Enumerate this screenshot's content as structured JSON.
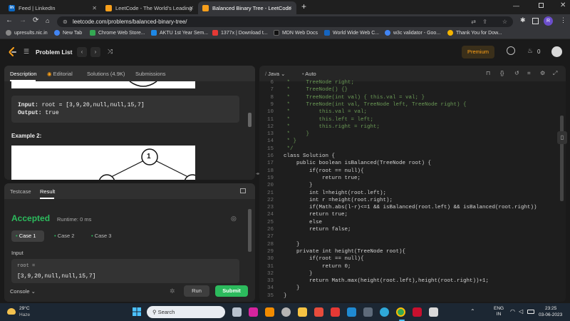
{
  "browser": {
    "tabs": [
      {
        "title": "Feed | LinkedIn",
        "icon": "linkedin-icon",
        "color": "#0a66c2",
        "glyph": "in"
      },
      {
        "title": "LeetCode - The World's Leading",
        "icon": "leetcode-icon",
        "color": "#f89f1b",
        "glyph": ""
      },
      {
        "title": "Balanced Binary Tree - LeetCode",
        "icon": "leetcode-icon",
        "color": "#f89f1b",
        "glyph": ""
      }
    ],
    "new_tab": "+",
    "url": "leetcode.com/problems/balanced-binary-tree/",
    "bookmarks": [
      {
        "label": "upresults.nic.in",
        "color": "#888"
      },
      {
        "label": "New Tab",
        "color": "#4285f4"
      },
      {
        "label": "Chrome Web Store...",
        "color": "#34a853"
      },
      {
        "label": "AKTU 1st Year Sem...",
        "color": "#1e88e5"
      },
      {
        "label": "1377x | Download t...",
        "color": "#e53935"
      },
      {
        "label": "MDN Web Docs",
        "color": "#111"
      },
      {
        "label": "World Wide Web C...",
        "color": "#1565c0"
      },
      {
        "label": "w3c validator - Goo...",
        "color": "#4285f4"
      },
      {
        "label": "Thank You for Dow...",
        "color": "#f4b400"
      }
    ]
  },
  "nav": {
    "problem_list": "Problem List",
    "premium": "Premium",
    "streak": "0"
  },
  "left": {
    "tabs": [
      "Description",
      "Editorial",
      "Solutions (4.9K)",
      "Submissions"
    ],
    "example_input_label": "Input:",
    "example_input_value": "root = [3,9,20,null,null,15,7]",
    "example_output_label": "Output:",
    "example_output_value": "true",
    "example2_title": "Example 2:",
    "tree_root": "1"
  },
  "bottom": {
    "tabs": [
      "Testcase",
      "Result"
    ],
    "status": "Accepted",
    "runtime": "Runtime: 0 ms",
    "cases": [
      "Case 1",
      "Case 2",
      "Case 3"
    ],
    "input_label": "Input",
    "param_name": "root =",
    "param_value": "[3,9,20,null,null,15,7]",
    "console": "Console",
    "run": "Run",
    "submit": "Submit"
  },
  "editor": {
    "language": "Java",
    "mode": "Auto",
    "lines": [
      {
        "n": "6",
        "t": " *     TreeNode right;",
        "c": "#6a9955"
      },
      {
        "n": "7",
        "t": " *     TreeNode() {}",
        "c": "#6a9955"
      },
      {
        "n": "8",
        "t": " *     TreeNode(int val) { this.val = val; }",
        "c": "#6a9955"
      },
      {
        "n": "9",
        "t": " *     TreeNode(int val, TreeNode left, TreeNode right) {",
        "c": "#6a9955"
      },
      {
        "n": "10",
        "t": " *         this.val = val;",
        "c": "#6a9955"
      },
      {
        "n": "11",
        "t": " *         this.left = left;",
        "c": "#6a9955"
      },
      {
        "n": "12",
        "t": " *         this.right = right;",
        "c": "#6a9955"
      },
      {
        "n": "13",
        "t": " *     }",
        "c": "#6a9955"
      },
      {
        "n": "14",
        "t": " * }",
        "c": "#6a9955"
      },
      {
        "n": "15",
        "t": " */",
        "c": "#6a9955"
      },
      {
        "n": "16",
        "t": "class Solution {",
        "c": "#d4d4d4"
      },
      {
        "n": "17",
        "t": "    public boolean isBalanced(TreeNode root) {",
        "c": "#d4d4d4"
      },
      {
        "n": "18",
        "t": "        if(root == null){",
        "c": "#d4d4d4"
      },
      {
        "n": "19",
        "t": "            return true;",
        "c": "#d4d4d4"
      },
      {
        "n": "20",
        "t": "        }",
        "c": "#d4d4d4"
      },
      {
        "n": "21",
        "t": "        int l=height(root.left);",
        "c": "#d4d4d4"
      },
      {
        "n": "22",
        "t": "        int r =height(root.right);",
        "c": "#d4d4d4"
      },
      {
        "n": "23",
        "t": "        if(Math.abs(l-r)<=1 && isBalanced(root.left) && isBalanced(root.right))",
        "c": "#d4d4d4"
      },
      {
        "n": "24",
        "t": "        return true;",
        "c": "#d4d4d4"
      },
      {
        "n": "25",
        "t": "        else",
        "c": "#d4d4d4"
      },
      {
        "n": "26",
        "t": "        return false;",
        "c": "#d4d4d4"
      },
      {
        "n": "27",
        "t": "",
        "c": "#d4d4d4"
      },
      {
        "n": "28",
        "t": "    }",
        "c": "#d4d4d4"
      },
      {
        "n": "29",
        "t": "    private int height(TreeNode root){",
        "c": "#d4d4d4"
      },
      {
        "n": "30",
        "t": "        if(root == null){",
        "c": "#d4d4d4"
      },
      {
        "n": "31",
        "t": "            return 0;",
        "c": "#d4d4d4"
      },
      {
        "n": "32",
        "t": "        }",
        "c": "#d4d4d4"
      },
      {
        "n": "33",
        "t": "        return Math.max(height(root.left),height(root.right))+1;",
        "c": "#d4d4d4"
      },
      {
        "n": "34",
        "t": "    }",
        "c": "#d4d4d4"
      },
      {
        "n": "35",
        "t": "}",
        "c": "#d4d4d4"
      }
    ]
  },
  "taskbar": {
    "weather_temp": "29°C",
    "weather_desc": "Haze",
    "search": "Search",
    "lang": "ENG",
    "region": "IN",
    "time": "23:25",
    "date": "03-06-2023"
  }
}
